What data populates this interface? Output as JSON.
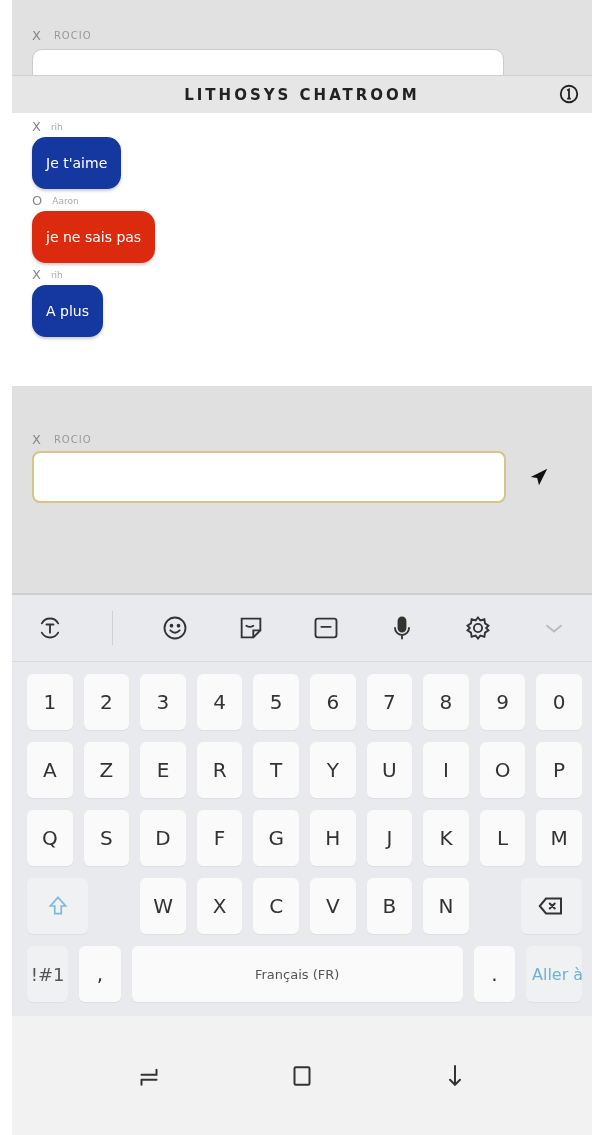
{
  "background_form": {
    "mark": "X",
    "label": "ROCIO"
  },
  "header": {
    "title": "LITHOSYS CHATROOM"
  },
  "messages": [
    {
      "mark": "X",
      "sender": "rih",
      "text": "Je t'aime",
      "color": "#1538a0"
    },
    {
      "mark": "O",
      "sender": "Aaron",
      "text": "je ne sais pas",
      "color": "#dc2a0e"
    },
    {
      "mark": "X",
      "sender": "rih",
      "text": "A plus",
      "color": "#1538a0"
    }
  ],
  "composer": {
    "mark": "X",
    "label": "ROCIO"
  },
  "keyboard": {
    "rows": [
      [
        {
          "kind": "char",
          "label": "1"
        },
        {
          "kind": "char",
          "label": "2"
        },
        {
          "kind": "char",
          "label": "3"
        },
        {
          "kind": "char",
          "label": "4"
        },
        {
          "kind": "char",
          "label": "5"
        },
        {
          "kind": "char",
          "label": "6"
        },
        {
          "kind": "char",
          "label": "7"
        },
        {
          "kind": "char",
          "label": "8"
        },
        {
          "kind": "char",
          "label": "9"
        },
        {
          "kind": "char",
          "label": "0"
        }
      ],
      [
        {
          "kind": "char",
          "label": "A"
        },
        {
          "kind": "char",
          "label": "Z"
        },
        {
          "kind": "char",
          "label": "E"
        },
        {
          "kind": "char",
          "label": "R"
        },
        {
          "kind": "char",
          "label": "T"
        },
        {
          "kind": "char",
          "label": "Y"
        },
        {
          "kind": "char",
          "label": "U"
        },
        {
          "kind": "char",
          "label": "I"
        },
        {
          "kind": "char",
          "label": "O"
        },
        {
          "kind": "char",
          "label": "P"
        }
      ],
      [
        {
          "kind": "char",
          "label": "Q"
        },
        {
          "kind": "char",
          "label": "S"
        },
        {
          "kind": "char",
          "label": "D"
        },
        {
          "kind": "char",
          "label": "F"
        },
        {
          "kind": "char",
          "label": "G"
        },
        {
          "kind": "char",
          "label": "H"
        },
        {
          "kind": "char",
          "label": "J"
        },
        {
          "kind": "char",
          "label": "K"
        },
        {
          "kind": "char",
          "label": "L"
        },
        {
          "kind": "char",
          "label": "M"
        }
      ],
      [
        {
          "kind": "shift"
        },
        {
          "kind": "gap"
        },
        {
          "kind": "char",
          "label": "W"
        },
        {
          "kind": "char",
          "label": "X"
        },
        {
          "kind": "char",
          "label": "C"
        },
        {
          "kind": "char",
          "label": "V"
        },
        {
          "kind": "char",
          "label": "B"
        },
        {
          "kind": "char",
          "label": "N"
        },
        {
          "kind": "gap"
        },
        {
          "kind": "backspace"
        }
      ]
    ],
    "bottom_row": {
      "symbols": "!#1",
      "comma": ",",
      "space": "Français (FR)",
      "period": ".",
      "action": "Aller à"
    }
  }
}
